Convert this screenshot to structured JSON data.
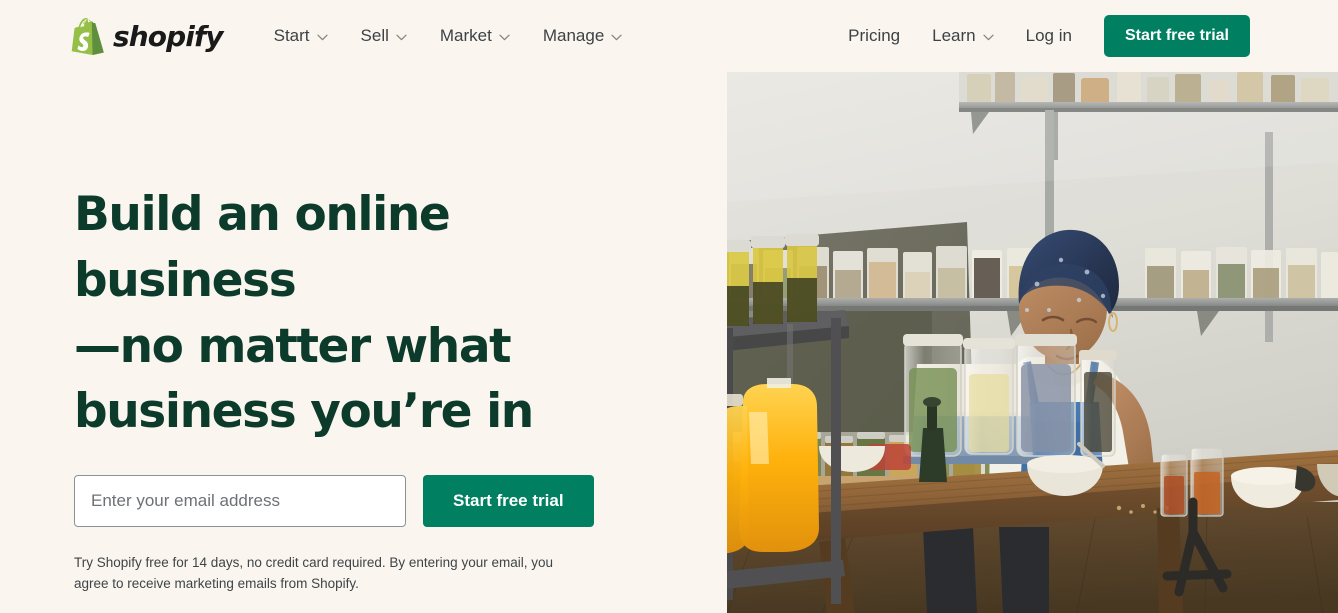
{
  "header": {
    "brand": {
      "wordmark": "shopify",
      "logo_icon": "shopify-bag-logo",
      "logo_color": "#95bf47"
    },
    "nav_main": [
      {
        "label": "Start",
        "icon": "chevron-down-icon"
      },
      {
        "label": "Sell",
        "icon": "chevron-down-icon"
      },
      {
        "label": "Market",
        "icon": "chevron-down-icon"
      },
      {
        "label": "Manage",
        "icon": "chevron-down-icon"
      }
    ],
    "nav_right": [
      {
        "label": "Pricing",
        "icon": null
      },
      {
        "label": "Learn",
        "icon": "chevron-down-icon"
      },
      {
        "label": "Log in",
        "icon": null
      }
    ],
    "cta_label": "Start free trial"
  },
  "hero": {
    "headline_line1": "Build an online business",
    "headline_line2": "—no matter what",
    "headline_line3": "business you’re in",
    "headline_color": "#0c3b2c",
    "email_placeholder": "Enter your email address",
    "email_value": "",
    "cta_label": "Start free trial",
    "fineprint": "Try Shopify free for 14 days, no credit card required. By entering your email, you agree to receive marketing emails from Shopify.",
    "image_alt": "Woman in blue head wrap and denim apron working at a laptop on a wooden table surrounded by glass jars of herbs and spices on metal shelves"
  },
  "theme": {
    "background": "#faf6ef",
    "accent_green": "#008060",
    "logo_green": "#95bf47",
    "text_dark": "#3d4246"
  }
}
